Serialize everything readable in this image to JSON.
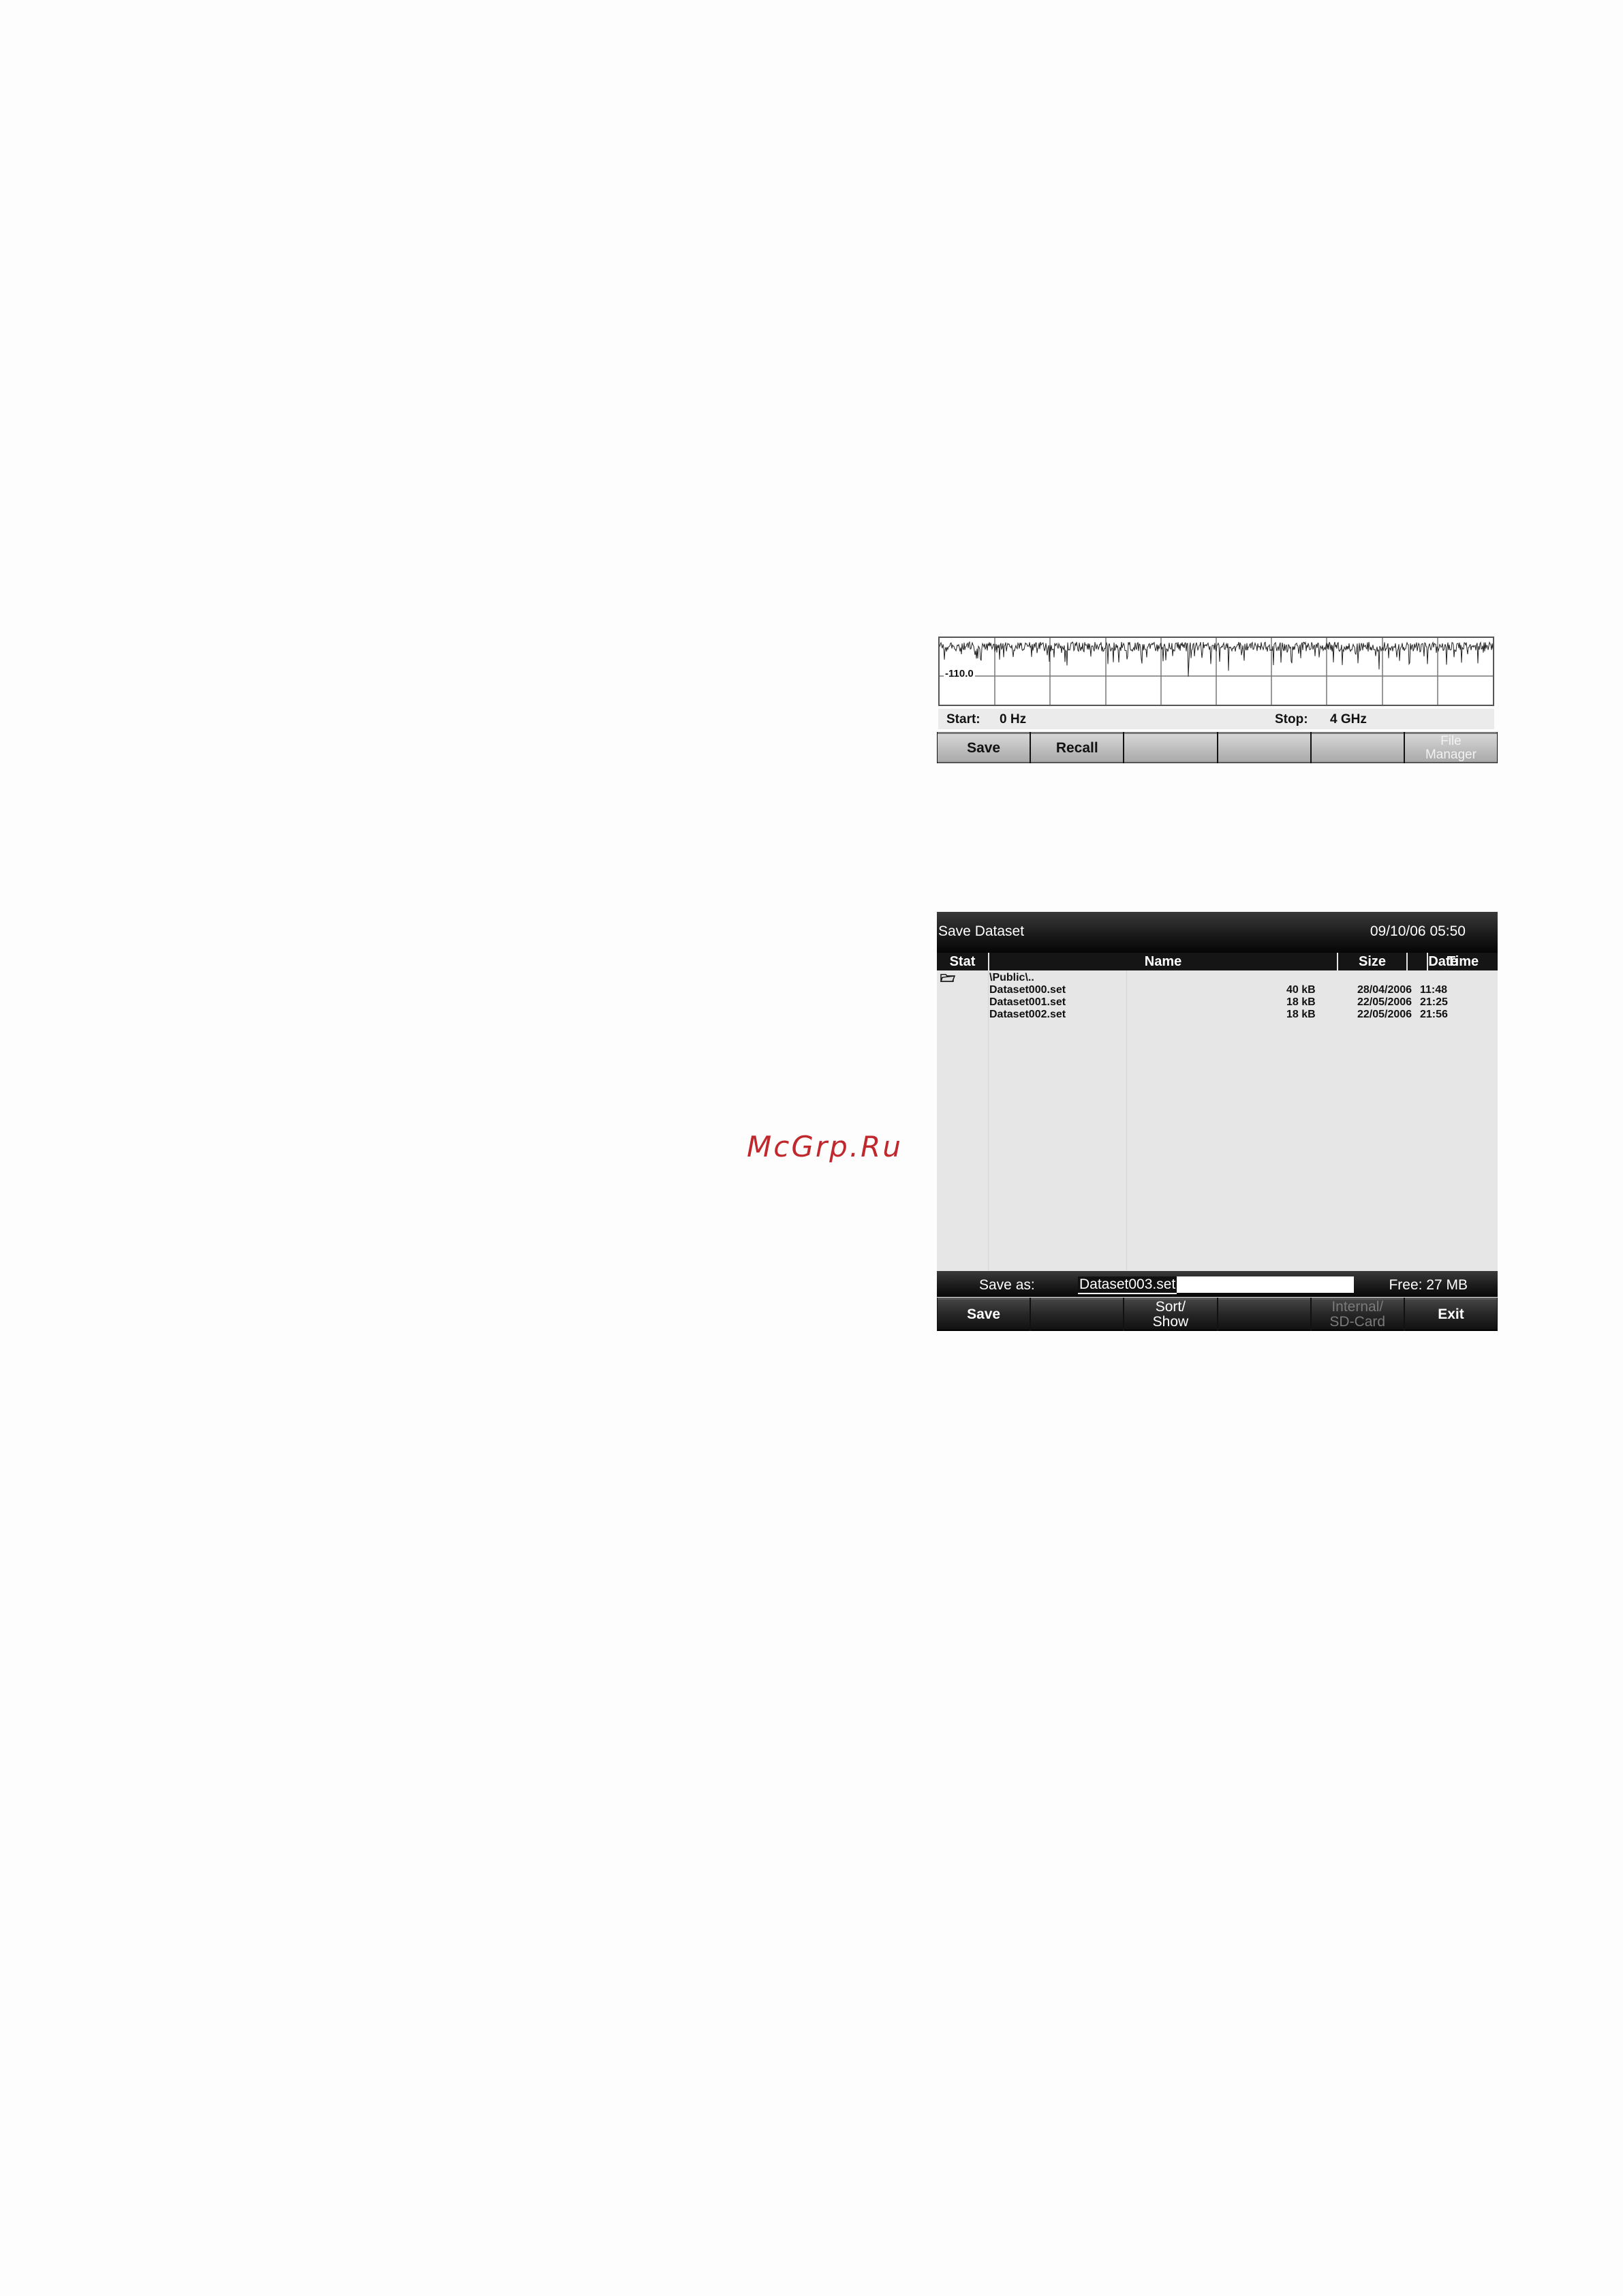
{
  "watermark": "McGrp.Ru",
  "spectrum_screen": {
    "ref_level": "-110.0",
    "start_label": "Start:",
    "start_value": "0 Hz",
    "stop_label": "Stop:",
    "stop_value": "4 GHz",
    "softkeys": [
      "Save",
      "Recall",
      "",
      "",
      "",
      "File\nManager"
    ]
  },
  "save_dialog": {
    "title": "Save Dataset",
    "datetime": "09/10/06 05:50",
    "columns": [
      "Stat",
      "Name",
      "Size",
      "Date",
      "Time"
    ],
    "folder": "\\Public\\..",
    "files": [
      {
        "name": "Dataset000.set",
        "size": "40 kB",
        "date": "28/04/2006",
        "time": "11:48"
      },
      {
        "name": "Dataset001.set",
        "size": "18 kB",
        "date": "22/05/2006",
        "time": "21:25"
      },
      {
        "name": "Dataset002.set",
        "size": "18 kB",
        "date": "22/05/2006",
        "time": "21:56"
      }
    ],
    "save_as_label": "Save as:",
    "save_as_value": "Dataset003.set",
    "free_space": "Free: 27 MB",
    "softkeys": [
      "Save",
      "",
      "Sort/\nShow",
      "",
      "Internal/\nSD-Card",
      "Exit"
    ]
  },
  "colors": {
    "title_bar": "#1b1b1b",
    "softkey_light": "#c8c8c8",
    "watermark": "#c0282d"
  },
  "icons": {
    "folder_status": "folder-icon"
  }
}
